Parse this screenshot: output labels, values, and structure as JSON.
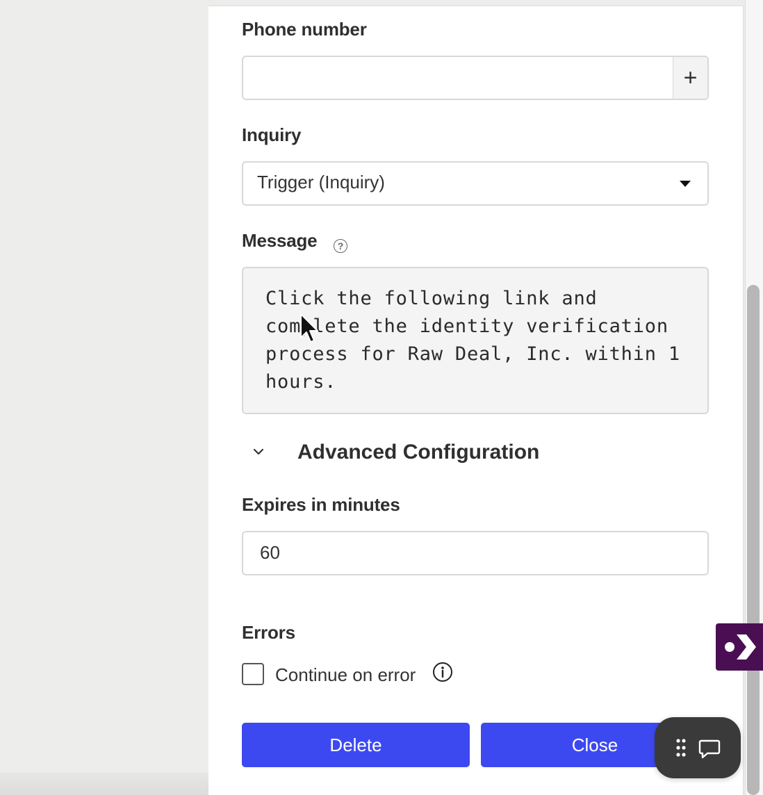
{
  "form": {
    "phone": {
      "label": "Phone number",
      "value": "",
      "add_symbol": "+"
    },
    "inquiry": {
      "label": "Inquiry",
      "selected": "Trigger (Inquiry)"
    },
    "message": {
      "label": "Message",
      "help_symbol": "?",
      "value": "Click the following link and\ncomplete the identity verification\nprocess for Raw Deal, Inc. within 1\nhours."
    },
    "advanced": {
      "title": "Advanced Configuration",
      "expanded": true
    },
    "expires": {
      "label": "Expires in minutes",
      "value": "60"
    },
    "errors": {
      "label": "Errors",
      "checkbox_label": "Continue on error",
      "checked": false
    },
    "buttons": {
      "delete": "Delete",
      "close": "Close"
    }
  },
  "colors": {
    "primary_button": "#3d49f0",
    "side_badge": "#4a0f52",
    "chat_widget": "#3a3a3a"
  },
  "icons": {
    "phone_add": "plus-icon",
    "inquiry_caret": "caret-down-icon",
    "message_help": "question-circle-icon",
    "advanced_toggle": "chevron-down-icon",
    "continue_info": "info-circle-icon",
    "side_badge": "chevron-right-badge-icon",
    "chat": "chat-bubble-icon",
    "drag": "grip-dots-icon"
  }
}
